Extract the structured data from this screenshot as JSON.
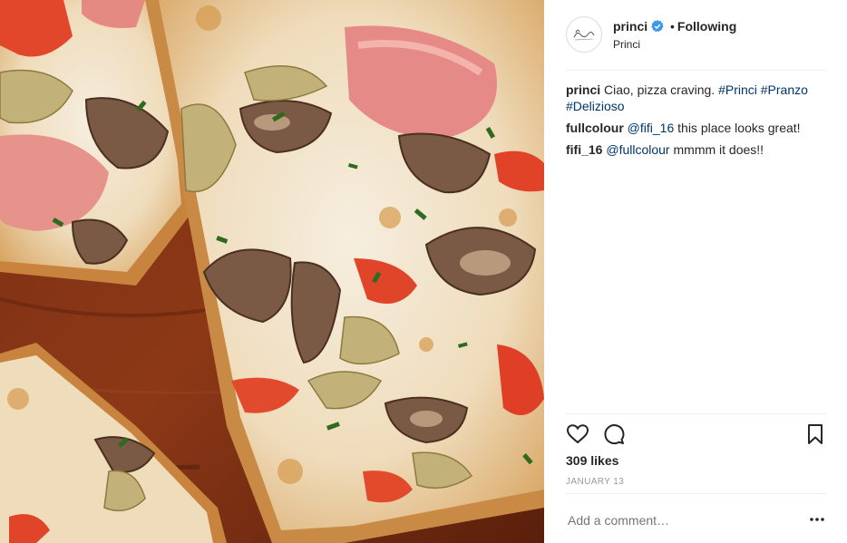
{
  "post": {
    "username": "princi",
    "follow_status": "Following",
    "location": "Princi",
    "separator": "•"
  },
  "caption": {
    "username": "princi",
    "text": "Ciao, pizza craving.",
    "hashtags": [
      "#Princi",
      "#Pranzo",
      "#Delizioso"
    ]
  },
  "comments": [
    {
      "username": "fullcolour",
      "mention": "@fifi_16",
      "text": "this place looks great!"
    },
    {
      "username": "fifi_16",
      "mention": "@fullcolour",
      "text": "mmmm it does!!"
    }
  ],
  "likes_text": "309 likes",
  "date_text": "JANUARY 13",
  "add_comment_placeholder": "Add a comment…",
  "icons": {
    "like": "heart-icon",
    "comment": "comment-icon",
    "save": "bookmark-icon",
    "more": "more-options-icon",
    "verified": "verified-badge-icon"
  },
  "colors": {
    "link": "#003569",
    "muted": "#999999",
    "verified": "#3897f0"
  }
}
